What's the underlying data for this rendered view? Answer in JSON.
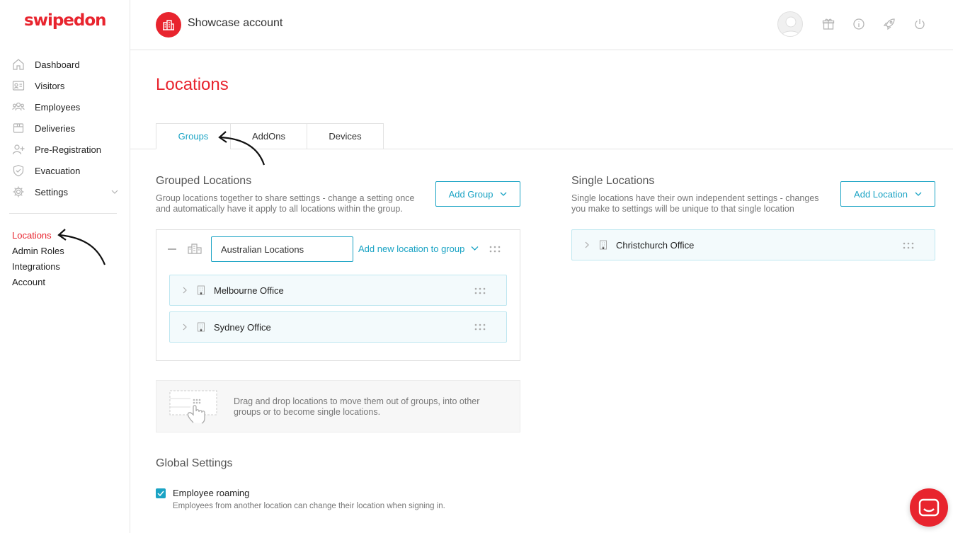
{
  "brand": {
    "logo_text": "swipedon",
    "accent": "#e8242e",
    "link": "#1aa3c4"
  },
  "sidebar": {
    "items": [
      {
        "label": "Dashboard",
        "icon": "home-icon"
      },
      {
        "label": "Visitors",
        "icon": "id-card-icon"
      },
      {
        "label": "Employees",
        "icon": "people-icon"
      },
      {
        "label": "Deliveries",
        "icon": "package-icon"
      },
      {
        "label": "Pre-Registration",
        "icon": "user-add-icon"
      },
      {
        "label": "Evacuation",
        "icon": "shield-icon"
      },
      {
        "label": "Settings",
        "icon": "gear-icon"
      }
    ],
    "subitems": [
      "Locations",
      "Admin Roles",
      "Integrations",
      "Account"
    ]
  },
  "header": {
    "account_name": "Showcase account"
  },
  "page": {
    "title": "Locations"
  },
  "tabs": [
    "Groups",
    "AddOns",
    "Devices"
  ],
  "grouped": {
    "title": "Grouped Locations",
    "desc_line1": "Group locations together to share settings - change a setting once",
    "desc_line2": "and automatically have it apply to all locations within the group.",
    "add_button": "Add Group",
    "group_name": "Australian Locations",
    "add_link": "Add new location to group",
    "locations": [
      "Melbourne Office",
      "Sydney Office"
    ]
  },
  "single": {
    "title": "Single Locations",
    "desc_line1": "Single locations have their own independent settings - changes",
    "desc_line2": "you make to settings will be unique to that single location",
    "add_button": "Add Location",
    "locations": [
      "Christchurch Office"
    ]
  },
  "drag_info": {
    "line1": "Drag and drop locations to move them out of groups, into other",
    "line2": "groups or to become single locations."
  },
  "global": {
    "title": "Global Settings",
    "checkbox_label": "Employee roaming",
    "checkbox_checked": true,
    "checkbox_desc": "Employees from another location can change their location when signing in."
  }
}
